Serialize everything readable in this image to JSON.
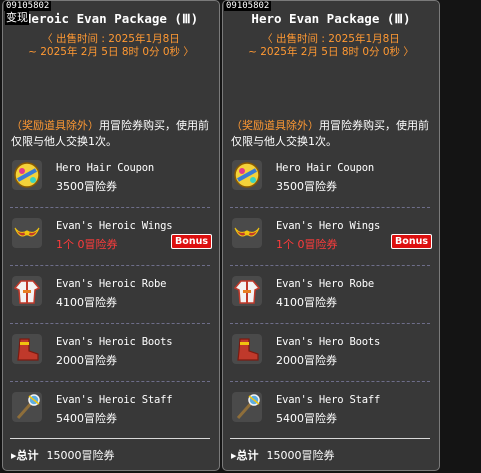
{
  "serial": "09105802",
  "left_prefix": "变现",
  "panels": [
    {
      "title": "Heroic Evan Package (Ⅲ)",
      "sale_line1": "〈 出售时间 : 2025年1月8日",
      "sale_line2": "~ 2025年 2月 5日 8时 0分 0秒 〉",
      "desc_orange": "（奖励道具除外）",
      "desc_white": "用冒险券购买，使用前仅限与他人交换1次。",
      "items": [
        {
          "name": "Hero Hair Coupon",
          "price": "3500冒险券",
          "icon": "hair-coupon-icon"
        },
        {
          "name": "Evan's Heroic Wings",
          "price": "1个 0冒险券",
          "icon": "wings-icon",
          "bonus": "Bonus"
        },
        {
          "name": "Evan's Heroic Robe",
          "price": "4100冒险券",
          "icon": "robe-icon"
        },
        {
          "name": "Evan's Heroic Boots",
          "price": "2000冒险券",
          "icon": "boots-icon"
        },
        {
          "name": "Evan's Heroic Staff",
          "price": "5400冒险券",
          "icon": "staff-icon"
        }
      ],
      "total_label": "总计",
      "total_value": "15000冒险券"
    },
    {
      "title": "Hero Evan Package (Ⅲ)",
      "sale_line1": "〈 出售时间 : 2025年1月8日",
      "sale_line2": "~ 2025年 2月 5日 8时 0分 0秒 〉",
      "desc_orange": "（奖励道具除外）",
      "desc_white": "用冒险券购买，使用前仅限与他人交换1次。",
      "items": [
        {
          "name": "Hero Hair Coupon",
          "price": "3500冒险券",
          "icon": "hair-coupon-icon"
        },
        {
          "name": "Evan's Hero Wings",
          "price": "1个 0冒险券",
          "icon": "wings-icon",
          "bonus": "Bonus"
        },
        {
          "name": "Evan's Hero Robe",
          "price": "4100冒险券",
          "icon": "robe-icon"
        },
        {
          "name": "Evan's Hero Boots",
          "price": "2000冒险券",
          "icon": "boots-icon"
        },
        {
          "name": "Evan's Hero Staff",
          "price": "5400冒险券",
          "icon": "staff-icon"
        }
      ],
      "total_label": "总计",
      "total_value": "15000冒险券"
    }
  ],
  "colors": {
    "panel_bg": "#383838",
    "orange": "#ff9933",
    "red_price": "#ff3b3b",
    "bonus_bg": "#dd1010"
  }
}
